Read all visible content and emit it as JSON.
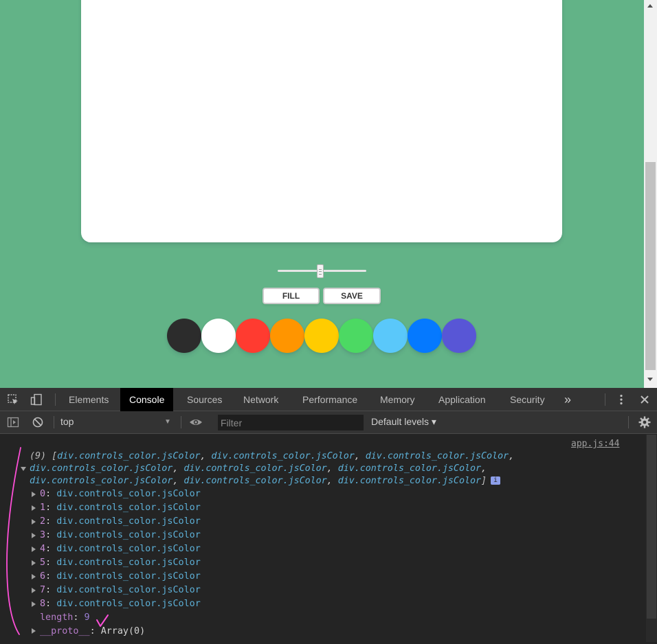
{
  "page": {
    "buttons": {
      "fill": "FILL",
      "save": "SAVE"
    },
    "brush_size_range": {
      "value_fraction": 0.48
    },
    "colors": [
      "#2c2c2c",
      "#ffffff",
      "#ff3b30",
      "#ff9500",
      "#ffcc00",
      "#4cd963",
      "#5ac8fa",
      "#0579ff",
      "#5856d6"
    ]
  },
  "devtools": {
    "tabs": [
      "Elements",
      "Console",
      "Sources",
      "Network",
      "Performance",
      "Memory",
      "Application",
      "Security"
    ],
    "active_tab": "Console",
    "more_tabs": "»",
    "context": "top",
    "filter_placeholder": "Filter",
    "levels": "Default levels ▾"
  },
  "console": {
    "source": "app.js:44",
    "summary": {
      "count": "(9)",
      "open": "[",
      "item": "div.controls_color.jsColor",
      "sep": ", ",
      "close": "]",
      "info": "i"
    },
    "entries": [
      {
        "key": "0",
        "value": "div.controls_color.jsColor"
      },
      {
        "key": "1",
        "value": "div.controls_color.jsColor"
      },
      {
        "key": "2",
        "value": "div.controls_color.jsColor"
      },
      {
        "key": "3",
        "value": "div.controls_color.jsColor"
      },
      {
        "key": "4",
        "value": "div.controls_color.jsColor"
      },
      {
        "key": "5",
        "value": "div.controls_color.jsColor"
      },
      {
        "key": "6",
        "value": "div.controls_color.jsColor"
      },
      {
        "key": "7",
        "value": "div.controls_color.jsColor"
      },
      {
        "key": "8",
        "value": "div.controls_color.jsColor"
      }
    ],
    "length": {
      "key": "length",
      "value": "9"
    },
    "proto": {
      "key": "__proto__",
      "value": "Array(0)"
    }
  }
}
